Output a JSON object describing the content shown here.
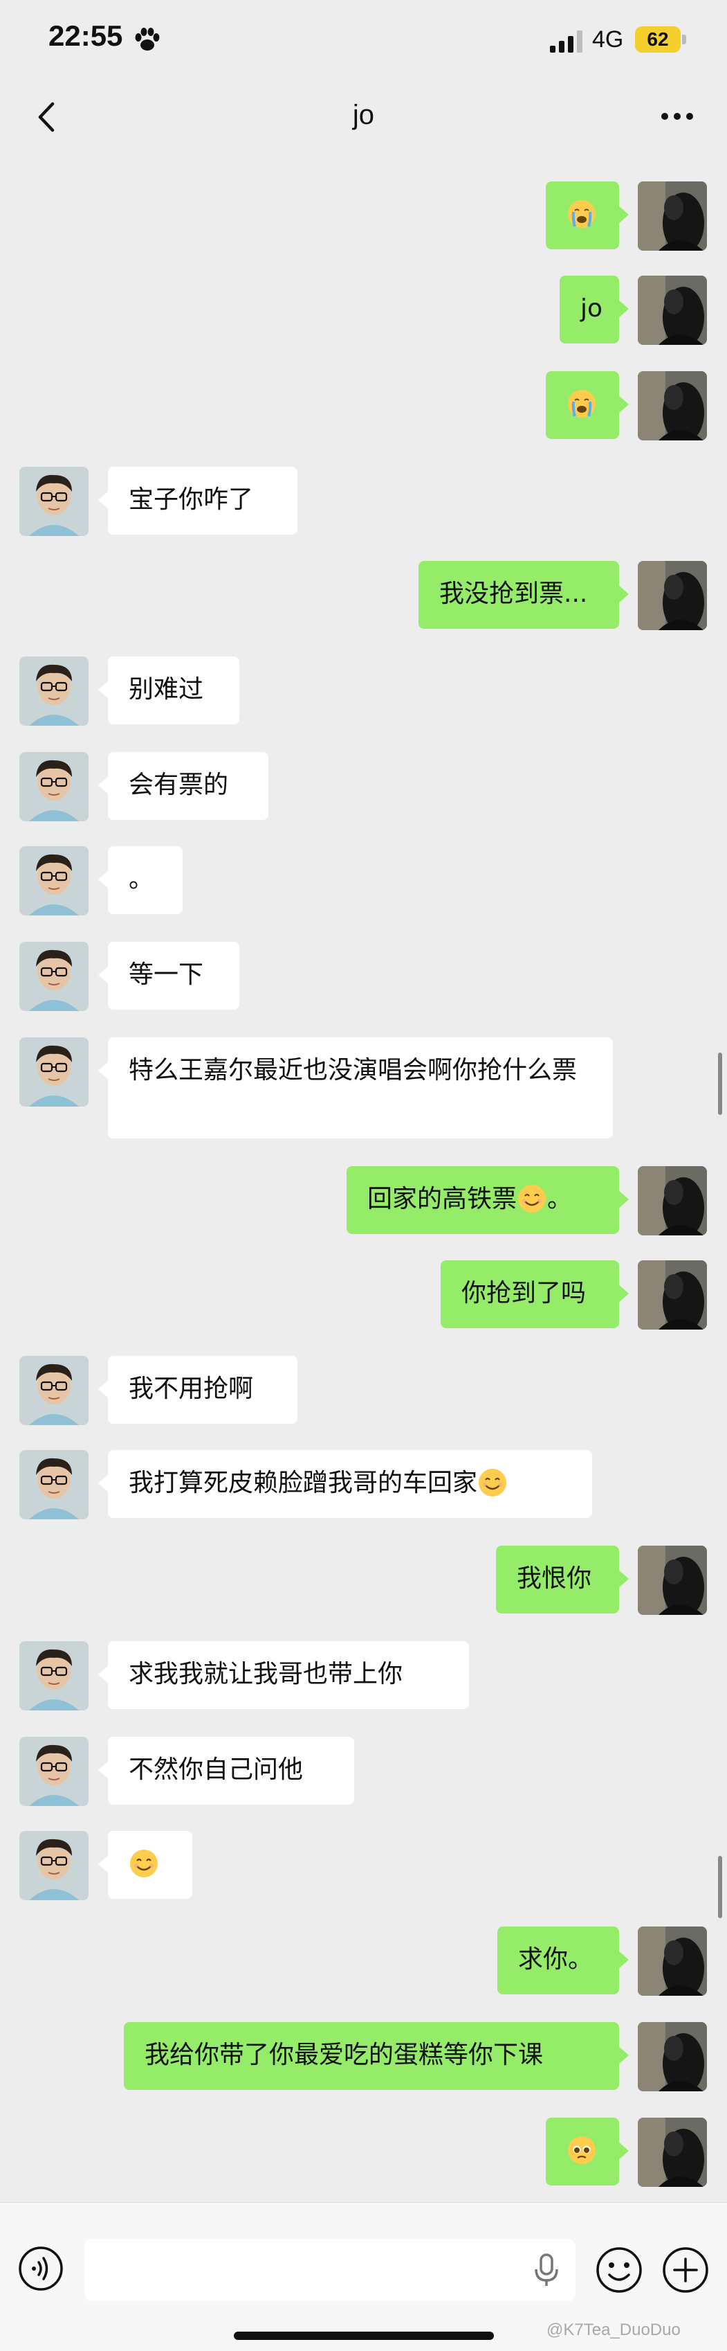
{
  "status": {
    "time": "22:55",
    "network": "4G",
    "battery": "62"
  },
  "header": {
    "title": "jo"
  },
  "messages": [
    {
      "from": "me",
      "text": "",
      "emoji": "crying-face"
    },
    {
      "from": "me",
      "text": "jo"
    },
    {
      "from": "me",
      "text": "",
      "emoji": "crying-face"
    },
    {
      "from": "them",
      "text": "宝子你咋了"
    },
    {
      "from": "me",
      "text": "我没抢到票..."
    },
    {
      "from": "them",
      "text": "别难过"
    },
    {
      "from": "them",
      "text": "会有票的"
    },
    {
      "from": "them",
      "text": "。"
    },
    {
      "from": "them",
      "text": "等一下"
    },
    {
      "from": "them",
      "text": "特么王嘉尔最近也没演唱会啊你抢什么票"
    },
    {
      "from": "me",
      "text": "回家的高铁票",
      "emoji": "smiling-face",
      "suffix": "。"
    },
    {
      "from": "me",
      "text": "你抢到了吗"
    },
    {
      "from": "them",
      "text": "我不用抢啊"
    },
    {
      "from": "them",
      "text": "我打算死皮赖脸蹭我哥的车回家",
      "emoji": "smiling-face"
    },
    {
      "from": "me",
      "text": "我恨你"
    },
    {
      "from": "them",
      "text": "求我我就让我哥也带上你"
    },
    {
      "from": "them",
      "text": "不然你自己问他"
    },
    {
      "from": "them",
      "text": "",
      "emoji": "smiling-face"
    },
    {
      "from": "me",
      "text": "求你。"
    },
    {
      "from": "me",
      "text": "我给你带了你最爱吃的蛋糕等你下课"
    },
    {
      "from": "me",
      "text": "",
      "emoji": "pleading-face"
    }
  ],
  "input": {
    "placeholder": ""
  },
  "watermark": "@K7Tea_DuoDuo",
  "colors": {
    "my_bubble": "#95ec69",
    "their_bubble": "#ffffff",
    "background": "#ededed"
  }
}
